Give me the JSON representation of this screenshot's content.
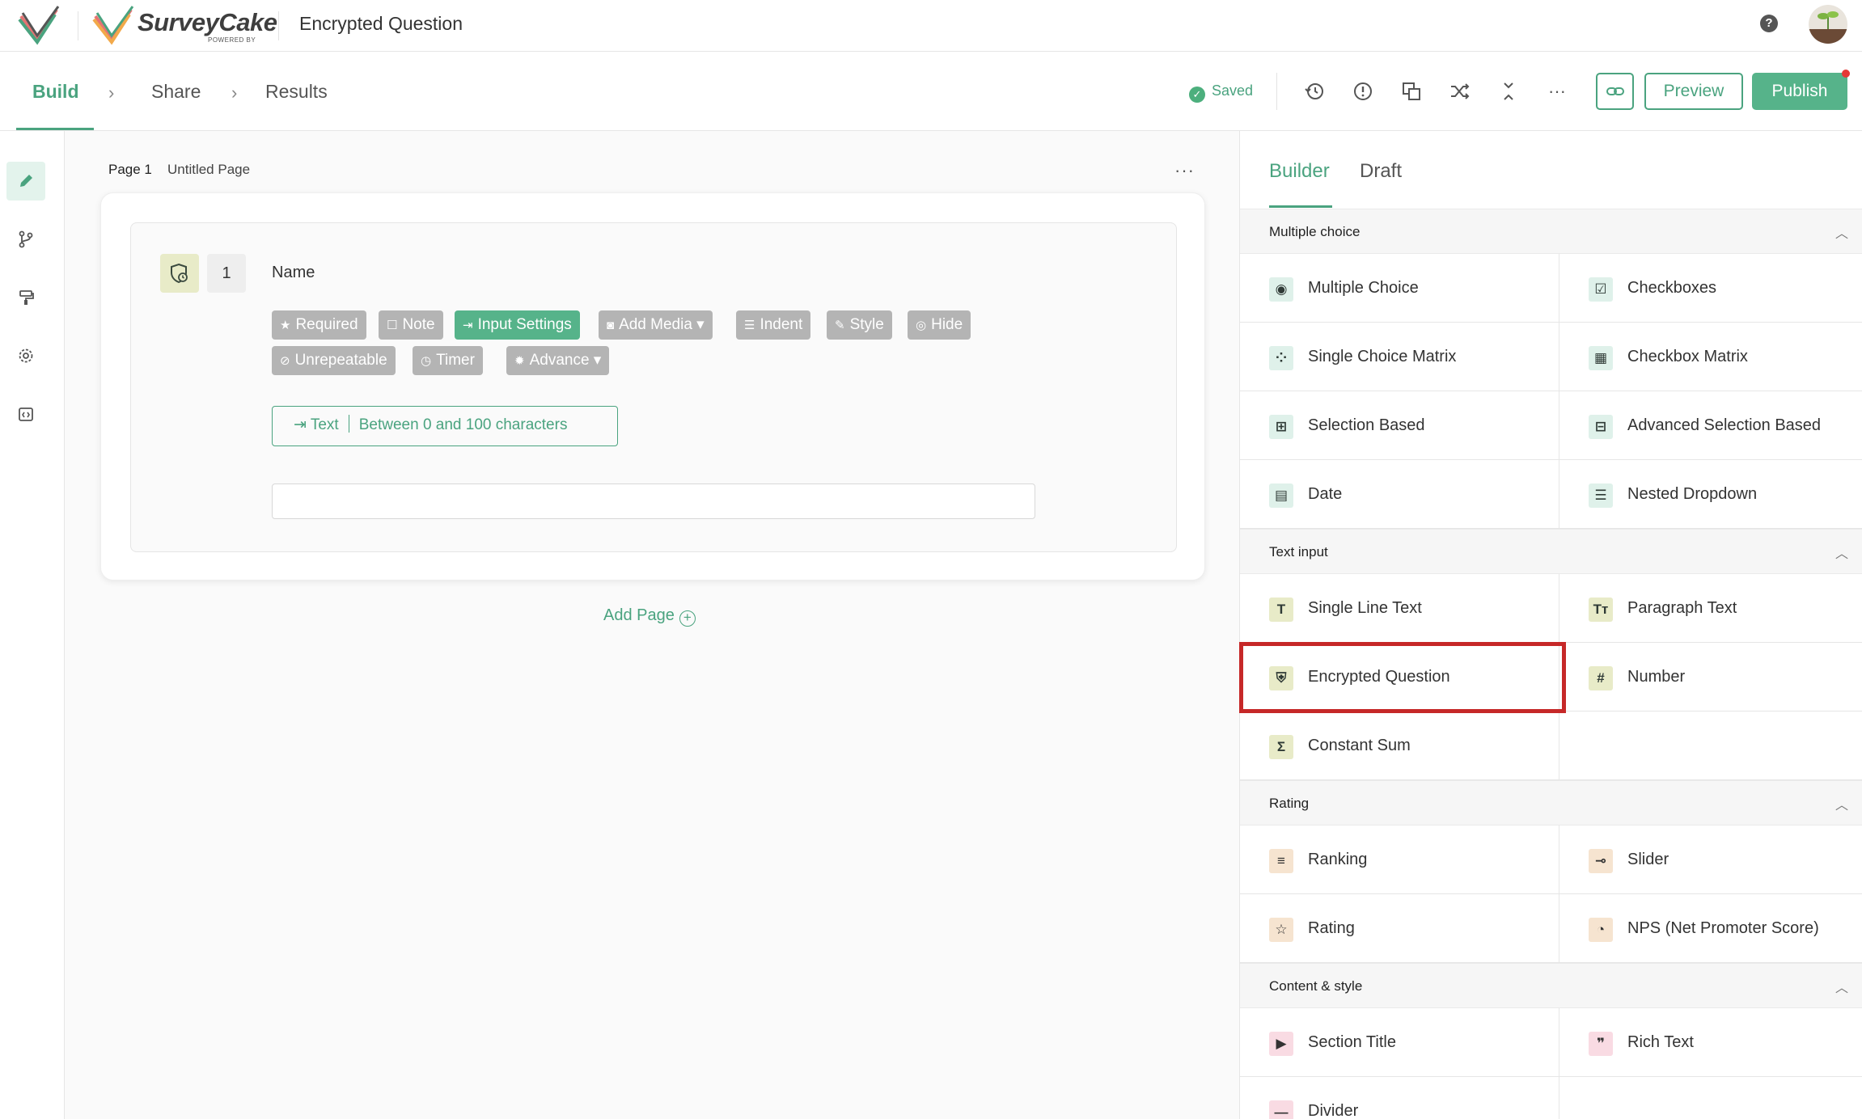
{
  "app": {
    "brand_name": "SurveyCake",
    "brand_sub": "POWERED BY",
    "survey_title": "Encrypted Question",
    "help_label": "?"
  },
  "steps": [
    {
      "label": "Build",
      "active": true
    },
    {
      "label": "Share",
      "active": false
    },
    {
      "label": "Results",
      "active": false
    }
  ],
  "toolbar": {
    "saved_label": "Saved",
    "preview_label": "Preview",
    "publish_label": "Publish",
    "more_label": "···",
    "icons": [
      "history-icon",
      "alert-icon",
      "copy-icon",
      "shuffle-icon",
      "collapse-icon",
      "more-icon"
    ]
  },
  "rail": [
    "pencil-icon",
    "branch-icon",
    "paint-roller-icon",
    "gear-icon",
    "code-icon"
  ],
  "page": {
    "label": "Page 1",
    "name": "Untitled Page",
    "more_label": "···",
    "add_page_label": "Add Page",
    "question": {
      "number": "1",
      "title": "Name",
      "chips": [
        {
          "icon": "★",
          "label": "Required"
        },
        {
          "icon": "☐",
          "label": "Note"
        },
        {
          "icon": "⇥",
          "label": "Input Settings"
        },
        {
          "icon": "◙",
          "label": "Add Media ▾"
        },
        {
          "icon": "☰",
          "label": "Indent"
        },
        {
          "icon": "✎",
          "label": "Style"
        },
        {
          "icon": "◎",
          "label": "Hide"
        },
        {
          "icon": "⊘",
          "label": "Unrepeatable"
        },
        {
          "icon": "◷",
          "label": "Timer"
        },
        {
          "icon": "✹",
          "label": "Advance ▾"
        }
      ],
      "limit_type": "Text",
      "limit_range": "Between 0 and 100 characters",
      "answer_value": ""
    }
  },
  "panel": {
    "tabs": [
      {
        "label": "Builder",
        "active": true
      },
      {
        "label": "Draft",
        "active": false
      }
    ],
    "sections": [
      {
        "title": "Multiple choice",
        "items": [
          {
            "label": "Multiple Choice",
            "icon": "◉",
            "icon_name": "radio-icon",
            "tone": "mint"
          },
          {
            "label": "Checkboxes",
            "icon": "☑",
            "icon_name": "checkbox-icon",
            "tone": "mint"
          },
          {
            "label": "Single Choice Matrix",
            "icon": "⁘",
            "icon_name": "matrix-radio-icon",
            "tone": "mint"
          },
          {
            "label": "Checkbox Matrix",
            "icon": "▦",
            "icon_name": "matrix-checkbox-icon",
            "tone": "mint"
          },
          {
            "label": "Selection Based",
            "icon": "⊞",
            "icon_name": "selection-icon",
            "tone": "mint"
          },
          {
            "label": "Advanced Selection Based",
            "icon": "⊟",
            "icon_name": "advanced-selection-icon",
            "tone": "mint"
          },
          {
            "label": "Date",
            "icon": "▤",
            "icon_name": "calendar-icon",
            "tone": "mint"
          },
          {
            "label": "Nested Dropdown",
            "icon": "☰",
            "icon_name": "nested-dropdown-icon",
            "tone": "mint"
          }
        ]
      },
      {
        "title": "Text input",
        "items": [
          {
            "label": "Single Line Text",
            "icon": "T",
            "icon_name": "text-icon",
            "tone": "olive"
          },
          {
            "label": "Paragraph Text",
            "icon": "Tт",
            "icon_name": "paragraph-icon",
            "tone": "olive"
          },
          {
            "label": "Encrypted Question",
            "icon": "⛨",
            "icon_name": "encrypted-icon",
            "tone": "olive"
          },
          {
            "label": "Number",
            "icon": "#",
            "icon_name": "number-icon",
            "tone": "olive"
          },
          {
            "label": "Constant Sum",
            "icon": "Σ",
            "icon_name": "sum-icon",
            "tone": "olive"
          }
        ]
      },
      {
        "title": "Rating",
        "items": [
          {
            "label": "Ranking",
            "icon": "≡",
            "icon_name": "ranking-icon",
            "tone": "peach"
          },
          {
            "label": "Slider",
            "icon": "⊸",
            "icon_name": "slider-icon",
            "tone": "peach"
          },
          {
            "label": "Rating",
            "icon": "☆",
            "icon_name": "star-icon",
            "tone": "peach"
          },
          {
            "label": "NPS (Net Promoter Score)",
            "icon": "◔",
            "icon_name": "nps-icon",
            "tone": "peach"
          }
        ]
      },
      {
        "title": "Content & style",
        "items": [
          {
            "label": "Section Title",
            "icon": "▶",
            "icon_name": "section-title-icon",
            "tone": "pink"
          },
          {
            "label": "Rich Text",
            "icon": "❞",
            "icon_name": "quote-icon",
            "tone": "pink"
          },
          {
            "label": "Divider",
            "icon": "—",
            "icon_name": "divider-icon",
            "tone": "pink"
          }
        ]
      }
    ]
  },
  "colors": {
    "accent": "#4aa37f",
    "publish": "#56b38a",
    "highlight": "#c62828"
  }
}
